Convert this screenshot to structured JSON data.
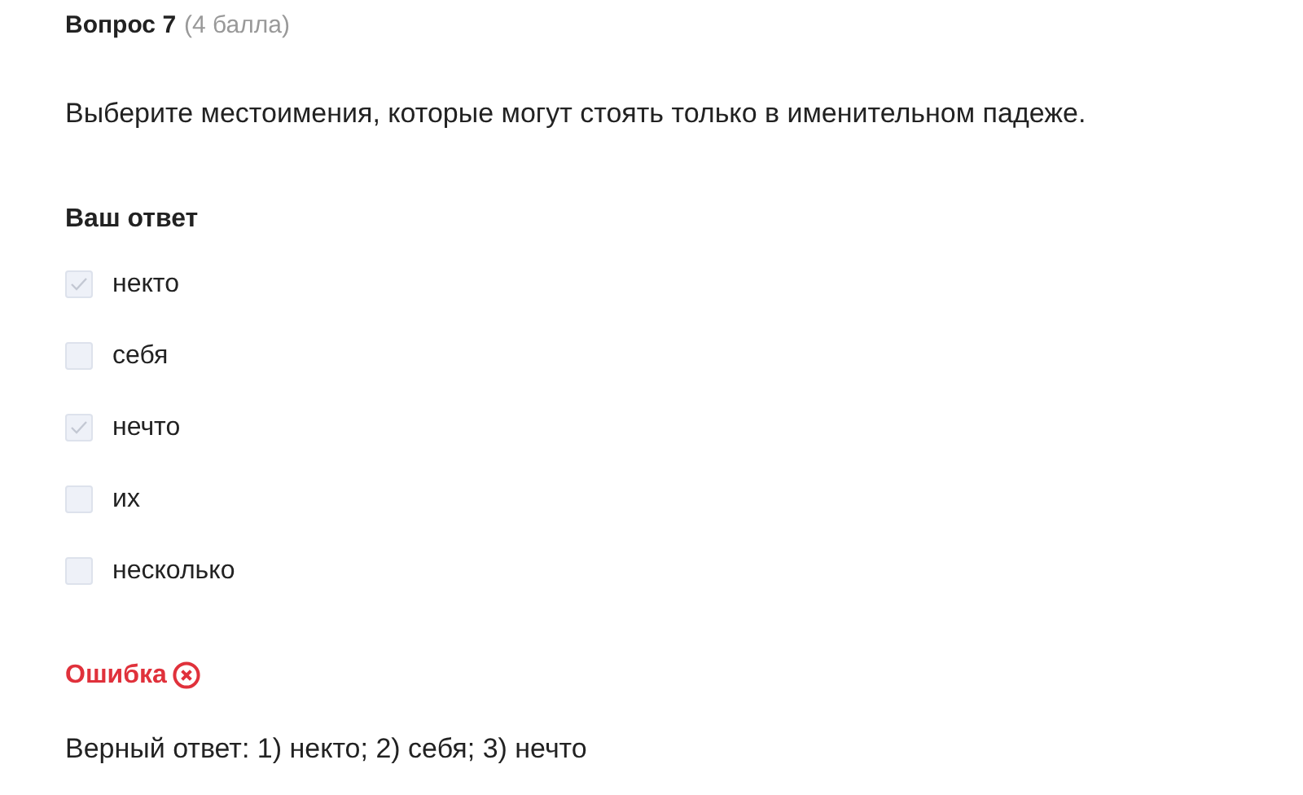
{
  "question": {
    "title": "Вопрос 7",
    "points": "(4 балла)",
    "text": "Выберите местоимения, которые могут стоять только в именительном падеже."
  },
  "answer": {
    "heading": "Ваш ответ",
    "options": [
      {
        "label": "некто",
        "checked": true,
        "disabled": true
      },
      {
        "label": "себя",
        "checked": false,
        "disabled": true
      },
      {
        "label": "нечто",
        "checked": true,
        "disabled": true
      },
      {
        "label": "их",
        "checked": false,
        "disabled": true
      },
      {
        "label": "несколько",
        "checked": false,
        "disabled": true
      }
    ]
  },
  "result": {
    "kind": "error",
    "label": "Ошибка",
    "correct_answer": "Верный ответ: 1) некто; 2) себя; 3) нечто"
  }
}
